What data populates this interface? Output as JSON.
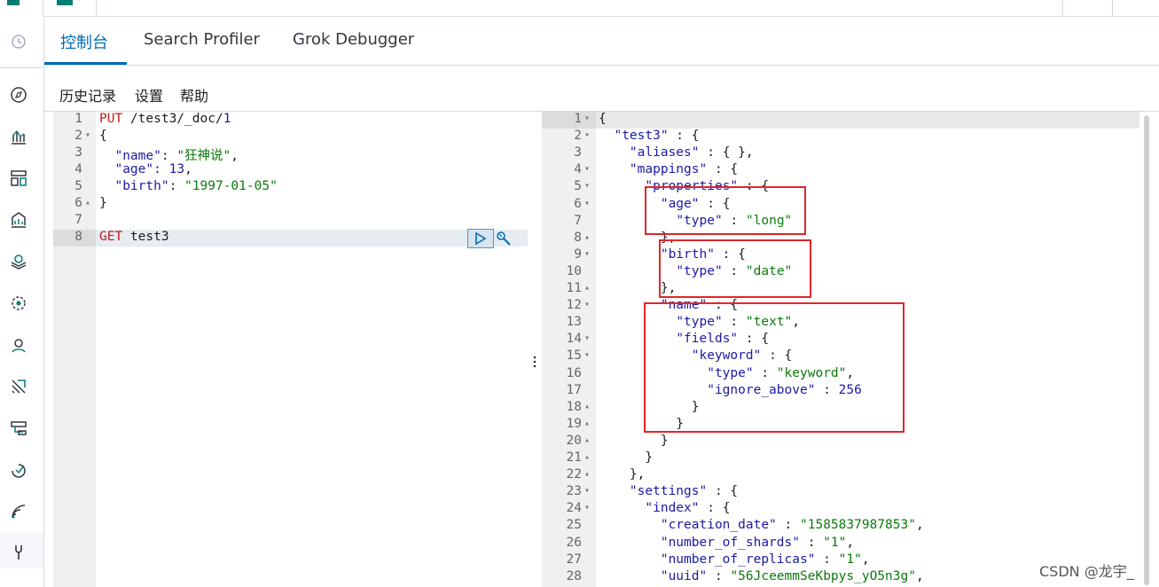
{
  "tabs": [
    {
      "label": "控制台",
      "active": true
    },
    {
      "label": "Search Profiler",
      "active": false
    },
    {
      "label": "Grok Debugger",
      "active": false
    }
  ],
  "menu": {
    "history": "历史记录",
    "settings": "设置",
    "help": "帮助"
  },
  "request_lines": [
    {
      "n": "1",
      "fold": "",
      "code": "PUT /test3/_doc/1"
    },
    {
      "n": "2",
      "fold": "▾",
      "code": "{"
    },
    {
      "n": "3",
      "fold": "",
      "code": "  \"name\": \"狂神说\","
    },
    {
      "n": "4",
      "fold": "",
      "code": "  \"age\": 13,"
    },
    {
      "n": "5",
      "fold": "",
      "code": "  \"birth\": \"1997-01-05\""
    },
    {
      "n": "6",
      "fold": "▴",
      "code": "}"
    },
    {
      "n": "7",
      "fold": "",
      "code": ""
    },
    {
      "n": "8",
      "fold": "",
      "code": "GET test3"
    }
  ],
  "response_lines": [
    {
      "n": "1",
      "fold": "▾",
      "code": "{"
    },
    {
      "n": "2",
      "fold": "▾",
      "code": "  \"test3\" : {"
    },
    {
      "n": "3",
      "fold": "",
      "code": "    \"aliases\" : { },"
    },
    {
      "n": "4",
      "fold": "▾",
      "code": "    \"mappings\" : {"
    },
    {
      "n": "5",
      "fold": "▾",
      "code": "      \"properties\" : {"
    },
    {
      "n": "6",
      "fold": "▾",
      "code": "        \"age\" : {"
    },
    {
      "n": "7",
      "fold": "",
      "code": "          \"type\" : \"long\""
    },
    {
      "n": "8",
      "fold": "▴",
      "code": "        },"
    },
    {
      "n": "9",
      "fold": "▾",
      "code": "        \"birth\" : {"
    },
    {
      "n": "10",
      "fold": "",
      "code": "          \"type\" : \"date\""
    },
    {
      "n": "11",
      "fold": "▴",
      "code": "        },"
    },
    {
      "n": "12",
      "fold": "▾",
      "code": "        \"name\" : {"
    },
    {
      "n": "13",
      "fold": "",
      "code": "          \"type\" : \"text\","
    },
    {
      "n": "14",
      "fold": "▾",
      "code": "          \"fields\" : {"
    },
    {
      "n": "15",
      "fold": "▾",
      "code": "            \"keyword\" : {"
    },
    {
      "n": "16",
      "fold": "",
      "code": "              \"type\" : \"keyword\","
    },
    {
      "n": "17",
      "fold": "",
      "code": "              \"ignore_above\" : 256"
    },
    {
      "n": "18",
      "fold": "▴",
      "code": "            }"
    },
    {
      "n": "19",
      "fold": "▴",
      "code": "          }"
    },
    {
      "n": "20",
      "fold": "▴",
      "code": "        }"
    },
    {
      "n": "21",
      "fold": "▴",
      "code": "      }"
    },
    {
      "n": "22",
      "fold": "▴",
      "code": "    },"
    },
    {
      "n": "23",
      "fold": "▾",
      "code": "    \"settings\" : {"
    },
    {
      "n": "24",
      "fold": "▾",
      "code": "      \"index\" : {"
    },
    {
      "n": "25",
      "fold": "",
      "code": "        \"creation_date\" : \"1585837987853\","
    },
    {
      "n": "26",
      "fold": "",
      "code": "        \"number_of_shards\" : \"1\","
    },
    {
      "n": "27",
      "fold": "",
      "code": "        \"number_of_replicas\" : \"1\","
    },
    {
      "n": "28",
      "fold": "",
      "code": "        \"uuid\" : \"56JceemmSeKbpys_yO5n3g\","
    }
  ],
  "watermark": "CSDN @龙宇_",
  "icons": [
    "clock-icon",
    "compass-icon",
    "chart-icon",
    "dashboard-icon",
    "canvas-icon",
    "maps-icon",
    "ml-icon",
    "graph-icon",
    "siem-icon",
    "infra-icon",
    "uptime-icon",
    "apm-icon",
    "devtools-icon",
    "play-icon",
    "wrench-icon"
  ],
  "colors": {
    "accent": "#006bb4",
    "highlight_box": "#e0262a",
    "string": "#0b7a0b",
    "key": "#1a1aa6",
    "method": "#c41a16"
  }
}
